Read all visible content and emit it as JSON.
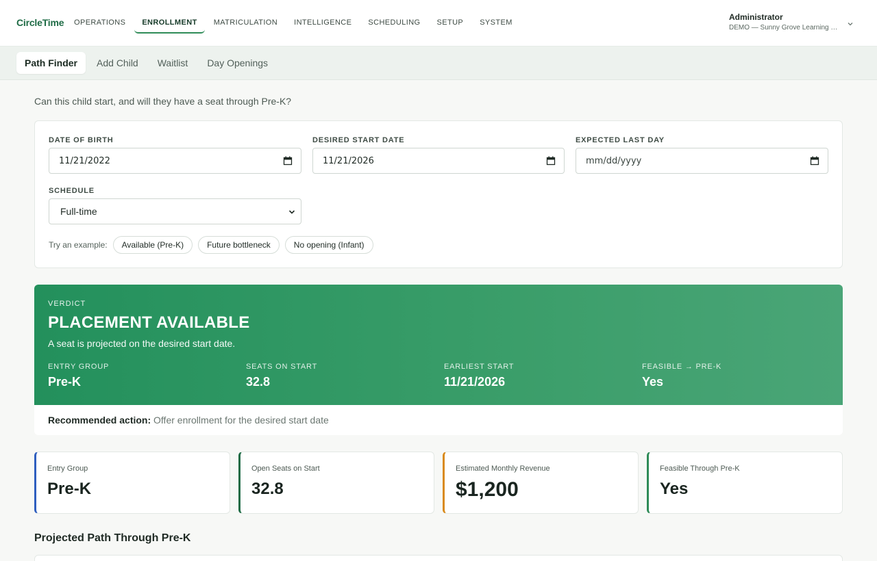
{
  "brand": {
    "name": "CircleTime"
  },
  "nav": {
    "items": [
      "OPERATIONS",
      "ENROLLMENT",
      "MATRICULATION",
      "INTELLIGENCE",
      "SCHEDULING",
      "SETUP",
      "SYSTEM"
    ],
    "active": "ENROLLMENT"
  },
  "user": {
    "name": "Administrator",
    "org": "DEMO — Sunny Grove Learning Ce..."
  },
  "subtabs": {
    "items": [
      "Path Finder",
      "Add Child",
      "Waitlist",
      "Day Openings"
    ],
    "active": "Path Finder"
  },
  "question": "Can this child start, and will they have a seat through Pre-K?",
  "form": {
    "dob": {
      "label": "DATE OF BIRTH",
      "value": "11/21/2022"
    },
    "start": {
      "label": "DESIRED START DATE",
      "value": "11/21/2026"
    },
    "last": {
      "label": "EXPECTED LAST DAY",
      "placeholder": "mm/dd/yyyy"
    },
    "schedule": {
      "label": "SCHEDULE",
      "value": "Full-time"
    },
    "examples_label": "Try an example:",
    "examples": [
      "Available (Pre-K)",
      "Future bottleneck",
      "No opening (Infant)"
    ]
  },
  "verdict": {
    "tag": "VERDICT",
    "title": "PLACEMENT AVAILABLE",
    "subtitle": "A seat is projected on the desired start date.",
    "metrics": [
      {
        "label": "ENTRY GROUP",
        "value": "Pre-K"
      },
      {
        "label": "SEATS ON START",
        "value": "32.8"
      },
      {
        "label": "EARLIEST START",
        "value": "11/21/2026"
      },
      {
        "label": "FEASIBLE → PRE-K",
        "value": "Yes"
      }
    ],
    "recommend_label": "Recommended action:",
    "recommend_text": "Offer enrollment for the desired start date"
  },
  "stats": [
    {
      "label": "Entry Group",
      "value": "Pre-K",
      "color": "#2f5fbf"
    },
    {
      "label": "Open Seats on Start",
      "value": "32.8",
      "color": "#1e6b45"
    },
    {
      "label": "Estimated Monthly Revenue",
      "value": "$1,200",
      "color": "#d98a1a"
    },
    {
      "label": "Feasible Through Pre-K",
      "value": "Yes",
      "color": "#2e8b57"
    }
  ],
  "section_title": "Projected Path Through Pre-K",
  "colors": {
    "accent": "#2e8b57",
    "verdict_green": "#2a955f"
  }
}
